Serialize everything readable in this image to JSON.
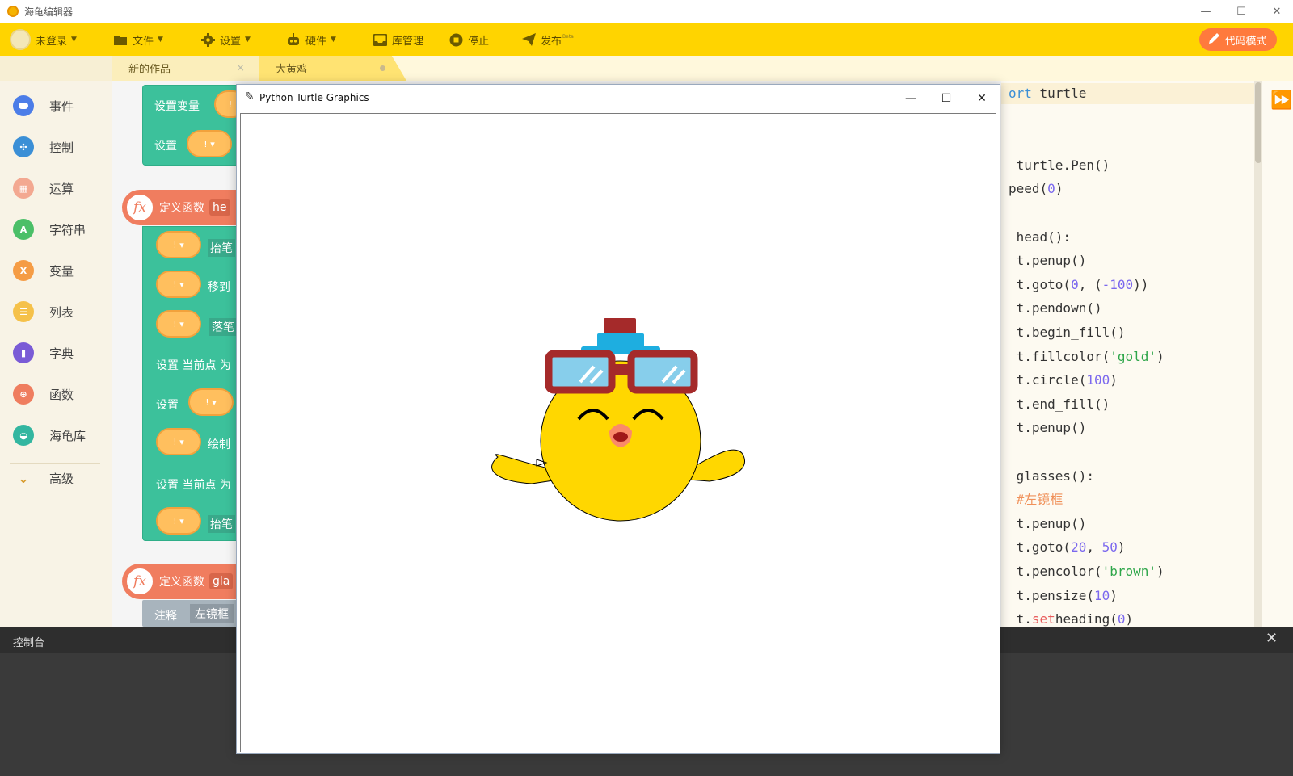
{
  "app": {
    "title": "海龟编辑器"
  },
  "window_controls": {
    "minimize": "—",
    "maximize": "☐",
    "close": "✕"
  },
  "menubar": {
    "login": "未登录",
    "file": "文件",
    "settings": "设置",
    "hardware": "硬件",
    "library": "库管理",
    "stop": "停止",
    "publish": "发布",
    "publish_badge": "Beta",
    "code_mode": "代码模式"
  },
  "tabs": [
    {
      "label": "新的作品",
      "close": "×"
    },
    {
      "label": "大黄鸡"
    }
  ],
  "sidebar": {
    "items": [
      {
        "label": "事件",
        "color": "#4c7de8",
        "icon": "event-icon"
      },
      {
        "label": "控制",
        "color": "#3b8fd6",
        "icon": "control-icon"
      },
      {
        "label": "运算",
        "color": "#f3a891",
        "icon": "operator-icon"
      },
      {
        "label": "字符串",
        "color": "#4bbf68",
        "icon": "string-icon"
      },
      {
        "label": "变量",
        "color": "#f59c45",
        "icon": "variable-icon"
      },
      {
        "label": "列表",
        "color": "#f5c14a",
        "icon": "list-icon"
      },
      {
        "label": "字典",
        "color": "#7a5bd6",
        "icon": "dict-icon"
      },
      {
        "label": "函数",
        "color": "#ef7d5f",
        "icon": "function-icon"
      },
      {
        "label": "海龟库",
        "color": "#33b6a0",
        "icon": "turtle-icon"
      },
      {
        "label": "高级",
        "color": "#d79a2b",
        "icon": "chevron-down-icon"
      }
    ]
  },
  "blocks": {
    "set_var": "设置变量",
    "set": "设置",
    "def_fn": "定义函数",
    "fn1_name": "he",
    "fn2_name": "gla",
    "pen_up": "抬笔",
    "move_to": "移到",
    "pen_down": "落笔",
    "set_current": "设置 当前点 为",
    "draw": "绘制",
    "comment": "注释",
    "comment_text": "左镜框"
  },
  "code": [
    {
      "parts": [
        {
          "t": "ort",
          "c": "kw"
        },
        {
          "t": " turtle"
        }
      ]
    },
    {
      "parts": []
    },
    {
      "parts": []
    },
    {
      "parts": [
        {
          "t": " turtle.Pen()"
        }
      ]
    },
    {
      "parts": [
        {
          "t": "peed("
        },
        {
          "t": "0",
          "c": "num"
        },
        {
          "t": ")"
        }
      ]
    },
    {
      "parts": []
    },
    {
      "parts": [
        {
          "t": " head():"
        }
      ]
    },
    {
      "parts": [
        {
          "t": " t.penup()"
        }
      ]
    },
    {
      "parts": [
        {
          "t": " t.goto("
        },
        {
          "t": "0",
          "c": "num"
        },
        {
          "t": ", ("
        },
        {
          "t": "-100",
          "c": "num"
        },
        {
          "t": "))"
        }
      ]
    },
    {
      "parts": [
        {
          "t": " t.pendown()"
        }
      ]
    },
    {
      "parts": [
        {
          "t": " t.begin_fill()"
        }
      ]
    },
    {
      "parts": [
        {
          "t": " t.fillcolor("
        },
        {
          "t": "'gold'",
          "c": "str"
        },
        {
          "t": ")"
        }
      ]
    },
    {
      "parts": [
        {
          "t": " t.circle("
        },
        {
          "t": "100",
          "c": "num"
        },
        {
          "t": ")"
        }
      ]
    },
    {
      "parts": [
        {
          "t": " t.end_fill()"
        }
      ]
    },
    {
      "parts": [
        {
          "t": " t.penup()"
        }
      ]
    },
    {
      "parts": []
    },
    {
      "parts": [
        {
          "t": " glasses():"
        }
      ]
    },
    {
      "parts": [
        {
          "t": " "
        },
        {
          "t": "#左镜框",
          "c": "cmt"
        }
      ]
    },
    {
      "parts": [
        {
          "t": " t.penup()"
        }
      ]
    },
    {
      "parts": [
        {
          "t": " t.goto("
        },
        {
          "t": "20",
          "c": "num"
        },
        {
          "t": ", "
        },
        {
          "t": "50",
          "c": "num"
        },
        {
          "t": ")"
        }
      ]
    },
    {
      "parts": [
        {
          "t": " t.pencolor("
        },
        {
          "t": "'brown'",
          "c": "str"
        },
        {
          "t": ")"
        }
      ]
    },
    {
      "parts": [
        {
          "t": " t.pensize("
        },
        {
          "t": "10",
          "c": "num"
        },
        {
          "t": ")"
        }
      ]
    },
    {
      "parts": [
        {
          "t": " t."
        },
        {
          "t": "set",
          "c": "red"
        },
        {
          "t": "heading("
        },
        {
          "t": "0",
          "c": "num"
        },
        {
          "t": ")"
        }
      ]
    }
  ],
  "console": {
    "title": "控制台",
    "close": "✕"
  },
  "turtle_window": {
    "title": "Python Turtle Graphics",
    "minimize": "—",
    "maximize": "☐",
    "close": "✕"
  },
  "colors": {
    "accent": "#ffd400",
    "code_mode_button": "#ff7a3d",
    "block_green": "#3cc19b",
    "function_orange": "#f07d5f",
    "chick_body": "#ffd700",
    "glasses_frame": "#a52a2a",
    "lens": "#87ceeb"
  }
}
